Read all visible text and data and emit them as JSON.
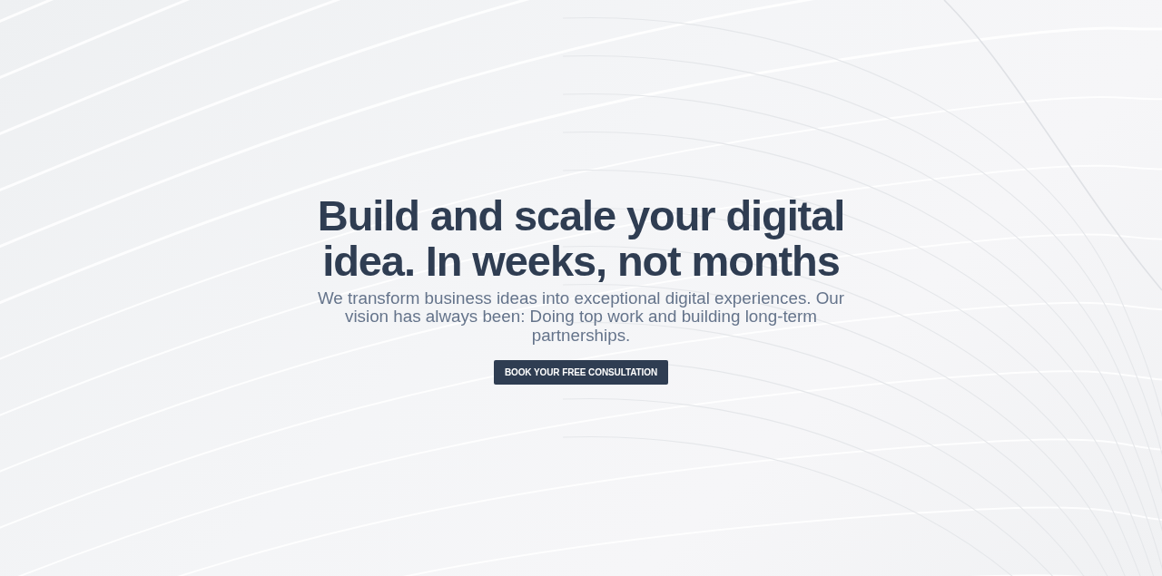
{
  "hero": {
    "title": "Build and scale your digital idea. In weeks, not months",
    "subtitle": "We transform business ideas into exceptional digital experiences. Our vision has always been: Doing top work and building long-term partnerships.",
    "button": {
      "label": "BOOK YOUR FREE CONSULTATION"
    }
  }
}
